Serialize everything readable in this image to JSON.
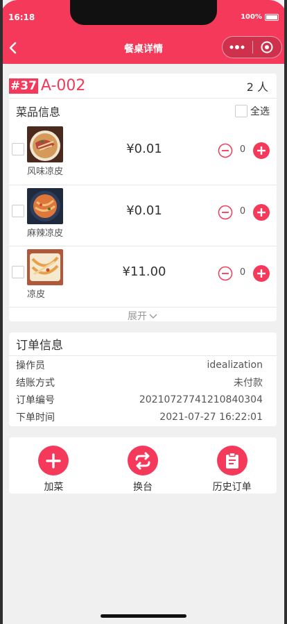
{
  "status_bar": {
    "time": "16:18",
    "battery": "100%"
  },
  "nav": {
    "title": "餐桌详情",
    "back_icon": "chevron-left-icon",
    "more_icon": "more-dots-icon",
    "close_icon": "target-circle-icon"
  },
  "table": {
    "number_tag": "#37",
    "name": "A-002",
    "guests": "2 人"
  },
  "dishes_section": {
    "title": "菜品信息",
    "select_all_label": "全选"
  },
  "dishes": [
    {
      "name": "风味凉皮",
      "price": "¥0.01",
      "qty": "0",
      "image_palette": [
        "#6b3b26",
        "#d49a5a",
        "#b8463a"
      ]
    },
    {
      "name": "麻辣凉皮",
      "price": "¥0.01",
      "qty": "0",
      "image_palette": [
        "#2d3d5a",
        "#e0773a",
        "#c94b2c"
      ]
    },
    {
      "name": "凉皮",
      "price": "¥11.00",
      "qty": "0",
      "image_palette": [
        "#b1573a",
        "#f2d59a",
        "#e8a04a"
      ]
    }
  ],
  "expand_label": "展开",
  "order": {
    "title": "订单信息",
    "rows": [
      {
        "label": "操作员",
        "value": "idealization"
      },
      {
        "label": "结账方式",
        "value": "未付款"
      },
      {
        "label": "订单编号",
        "value": "20210727741210840304"
      },
      {
        "label": "下单时间",
        "value": "2021-07-27 16:22:01"
      }
    ]
  },
  "actions": [
    {
      "label": "加菜",
      "icon": "plus-icon"
    },
    {
      "label": "换台",
      "icon": "swap-arrows-icon"
    },
    {
      "label": "历史订单",
      "icon": "clipboard-icon"
    }
  ],
  "colors": {
    "accent": "#f4395a",
    "background": "#f0f0f0"
  }
}
